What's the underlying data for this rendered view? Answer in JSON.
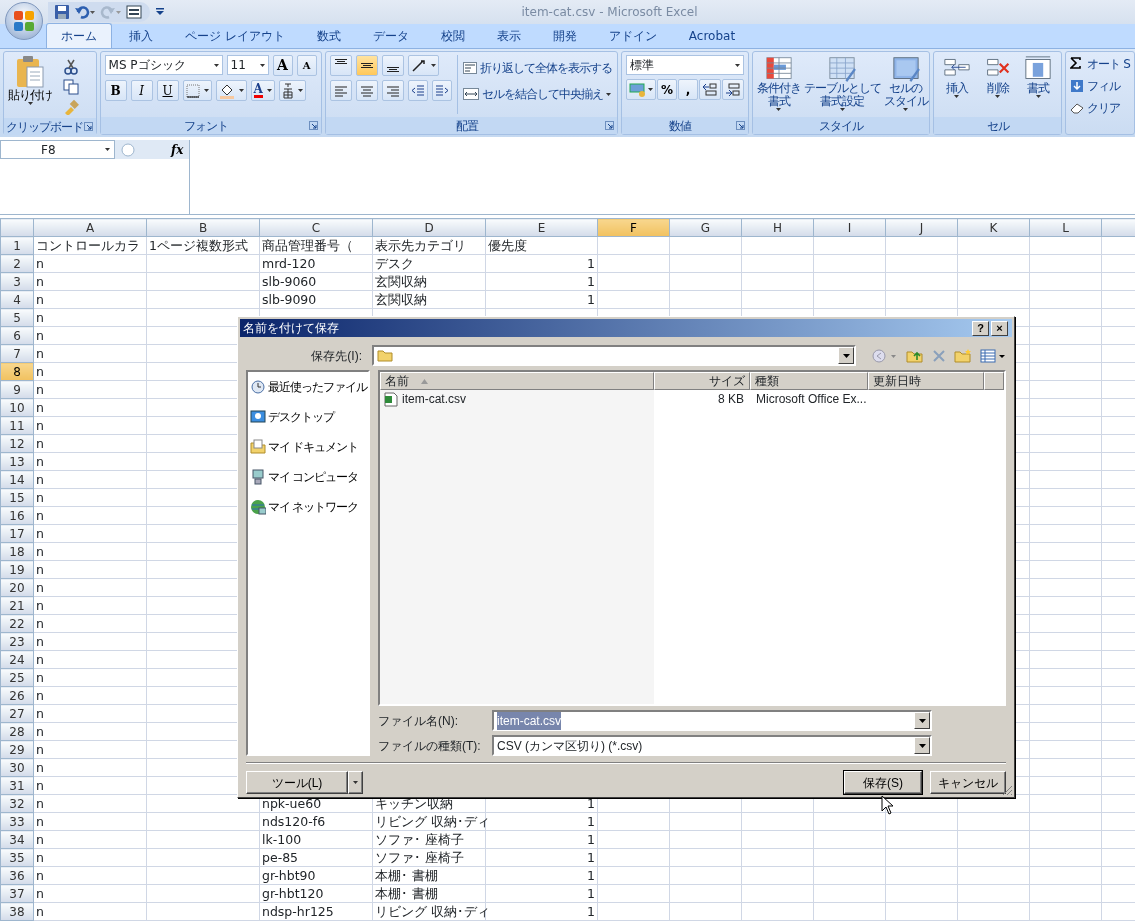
{
  "window": {
    "title": "item-cat.csv - Microsoft Excel"
  },
  "tabs": [
    {
      "label": "ホーム",
      "selected": true
    },
    {
      "label": "挿入",
      "selected": false
    },
    {
      "label": "ページ レイアウト",
      "selected": false
    },
    {
      "label": "数式",
      "selected": false
    },
    {
      "label": "データ",
      "selected": false
    },
    {
      "label": "校閲",
      "selected": false
    },
    {
      "label": "表示",
      "selected": false
    },
    {
      "label": "開発",
      "selected": false
    },
    {
      "label": "アドイン",
      "selected": false
    },
    {
      "label": "Acrobat",
      "selected": false
    }
  ],
  "ribbon": {
    "groups": [
      {
        "kind": "clipboard",
        "label": "クリップボード",
        "paste": "貼り付け"
      },
      {
        "kind": "font",
        "label": "フォント",
        "font_name": "MS Pゴシック",
        "font_size": "11",
        "grow": "A",
        "shrink": "A",
        "styles": [
          "B",
          "I",
          "U"
        ],
        "font_color": "A"
      },
      {
        "kind": "align",
        "label": "配置",
        "vertical_align": [
          {
            "selected": false
          },
          {
            "selected": true
          },
          {
            "selected": false
          }
        ],
        "wrap": "折り返して全体を表示する",
        "merge": "セルを結合して中央揃え"
      },
      {
        "kind": "number",
        "label": "数値",
        "format": "標準",
        "percent": "%",
        "comma": ","
      },
      {
        "kind": "styles",
        "label": "スタイル",
        "buttons": [
          [
            "条件付き",
            "書式"
          ],
          [
            "テーブルとして",
            "書式設定"
          ],
          [
            "セルの",
            "スタイル"
          ]
        ]
      },
      {
        "kind": "cells",
        "label": "セル",
        "buttons": [
          "挿入",
          "削除",
          "書式"
        ]
      },
      {
        "kind": "editing",
        "buttons": [
          "オート S",
          "フィル",
          "クリア"
        ]
      }
    ]
  },
  "formula_bar": {
    "name_box": "F8",
    "fx": "fx"
  },
  "sheet": {
    "columns": [
      {
        "label": "A",
        "selected": false
      },
      {
        "label": "B",
        "selected": false
      },
      {
        "label": "C",
        "selected": false
      },
      {
        "label": "D",
        "selected": false
      },
      {
        "label": "E",
        "selected": false
      },
      {
        "label": "F",
        "selected": true
      },
      {
        "label": "G",
        "selected": false
      },
      {
        "label": "H",
        "selected": false
      },
      {
        "label": "I",
        "selected": false
      },
      {
        "label": "J",
        "selected": false
      },
      {
        "label": "K",
        "selected": false
      },
      {
        "label": "L",
        "selected": false
      }
    ],
    "rows": [
      {
        "num": "1",
        "selected": false,
        "kind": "header",
        "cells": [
          "コントロールカラ",
          "1ページ複数形式",
          "商品管理番号（",
          "表示先カテゴリ",
          "優先度"
        ]
      },
      {
        "num": "2",
        "selected": false,
        "kind": "data",
        "cells": [
          "n",
          "",
          "mrd-120",
          "デスク",
          "1"
        ]
      },
      {
        "num": "3",
        "selected": false,
        "kind": "data",
        "cells": [
          "n",
          "",
          "slb-9060",
          "玄関収納",
          "1"
        ]
      },
      {
        "num": "4",
        "selected": false,
        "kind": "data",
        "cells": [
          "n",
          "",
          "slb-9090",
          "玄関収納",
          "1"
        ]
      },
      {
        "num": "5",
        "selected": false,
        "kind": "data",
        "cells": [
          "n"
        ]
      },
      {
        "num": "6",
        "selected": false,
        "kind": "data",
        "cells": [
          "n"
        ]
      },
      {
        "num": "7",
        "selected": false,
        "kind": "data",
        "cells": [
          "n"
        ]
      },
      {
        "num": "8",
        "selected": true,
        "kind": "data",
        "cells": [
          "n"
        ]
      },
      {
        "num": "9",
        "selected": false,
        "kind": "data",
        "cells": [
          "n"
        ]
      },
      {
        "num": "10",
        "selected": false,
        "kind": "data",
        "cells": [
          "n"
        ]
      },
      {
        "num": "11",
        "selected": false,
        "kind": "data",
        "cells": [
          "n"
        ]
      },
      {
        "num": "12",
        "selected": false,
        "kind": "data",
        "cells": [
          "n"
        ]
      },
      {
        "num": "13",
        "selected": false,
        "kind": "data",
        "cells": [
          "n"
        ]
      },
      {
        "num": "14",
        "selected": false,
        "kind": "data",
        "cells": [
          "n"
        ]
      },
      {
        "num": "15",
        "selected": false,
        "kind": "data",
        "cells": [
          "n"
        ]
      },
      {
        "num": "16",
        "selected": false,
        "kind": "data",
        "cells": [
          "n"
        ]
      },
      {
        "num": "17",
        "selected": false,
        "kind": "data",
        "cells": [
          "n"
        ]
      },
      {
        "num": "18",
        "selected": false,
        "kind": "data",
        "cells": [
          "n"
        ]
      },
      {
        "num": "19",
        "selected": false,
        "kind": "data",
        "cells": [
          "n"
        ]
      },
      {
        "num": "20",
        "selected": false,
        "kind": "data",
        "cells": [
          "n"
        ]
      },
      {
        "num": "21",
        "selected": false,
        "kind": "data",
        "cells": [
          "n"
        ]
      },
      {
        "num": "22",
        "selected": false,
        "kind": "data",
        "cells": [
          "n"
        ]
      },
      {
        "num": "23",
        "selected": false,
        "kind": "data",
        "cells": [
          "n"
        ]
      },
      {
        "num": "24",
        "selected": false,
        "kind": "data",
        "cells": [
          "n"
        ]
      },
      {
        "num": "25",
        "selected": false,
        "kind": "data",
        "cells": [
          "n"
        ]
      },
      {
        "num": "26",
        "selected": false,
        "kind": "data",
        "cells": [
          "n"
        ]
      },
      {
        "num": "27",
        "selected": false,
        "kind": "data",
        "cells": [
          "n"
        ]
      },
      {
        "num": "28",
        "selected": false,
        "kind": "data",
        "cells": [
          "n"
        ]
      },
      {
        "num": "29",
        "selected": false,
        "kind": "data",
        "cells": [
          "n"
        ]
      },
      {
        "num": "30",
        "selected": false,
        "kind": "data",
        "cells": [
          "n"
        ]
      },
      {
        "num": "31",
        "selected": false,
        "kind": "data",
        "cells": [
          "n"
        ]
      },
      {
        "num": "32",
        "selected": false,
        "kind": "data",
        "cells": [
          "n",
          "",
          "npk-ue60",
          "キッチン収納",
          "1"
        ]
      },
      {
        "num": "33",
        "selected": false,
        "kind": "data",
        "cells": [
          "n",
          "",
          "nds120-f6",
          "リビング 収納･ディ",
          "1"
        ]
      },
      {
        "num": "34",
        "selected": false,
        "kind": "data",
        "cells": [
          "n",
          "",
          "lk-100",
          "ソファ･ 座椅子",
          "1"
        ]
      },
      {
        "num": "35",
        "selected": false,
        "kind": "data",
        "cells": [
          "n",
          "",
          "pe-85",
          "ソファ･ 座椅子",
          "1"
        ]
      },
      {
        "num": "36",
        "selected": false,
        "kind": "data",
        "cells": [
          "n",
          "",
          "gr-hbt90",
          "本棚･ 書棚",
          "1"
        ]
      },
      {
        "num": "37",
        "selected": false,
        "kind": "data",
        "cells": [
          "n",
          "",
          "gr-hbt120",
          "本棚･ 書棚",
          "1"
        ]
      },
      {
        "num": "38",
        "selected": false,
        "kind": "data",
        "cells": [
          "n",
          "",
          "ndsp-hr125",
          "リビング 収納･ディ",
          "1"
        ]
      }
    ]
  },
  "dialog": {
    "title": "名前を付けて保存",
    "help": "?",
    "close": "×",
    "save_in_label": "保存先(I):",
    "places": [
      "最近使ったファイル",
      "デスクトップ",
      "マイ ドキュメント",
      "マイ コンピュータ",
      "マイ ネットワーク"
    ],
    "columns": [
      "名前",
      "サイズ",
      "種類",
      "更新日時"
    ],
    "files": [
      {
        "name": "item-cat.csv",
        "size": "8 KB",
        "type": "Microsoft Office Ex..."
      }
    ],
    "file_name_label": "ファイル名(N):",
    "file_name": "item-cat.csv",
    "file_name_selected": true,
    "file_type_label": "ファイルの種類(T):",
    "file_type": "CSV (カンマ区切り) (*.csv)",
    "tools_button": "ツール(L)",
    "save_button": "保存(S)",
    "cancel_button": "キャンセル"
  }
}
